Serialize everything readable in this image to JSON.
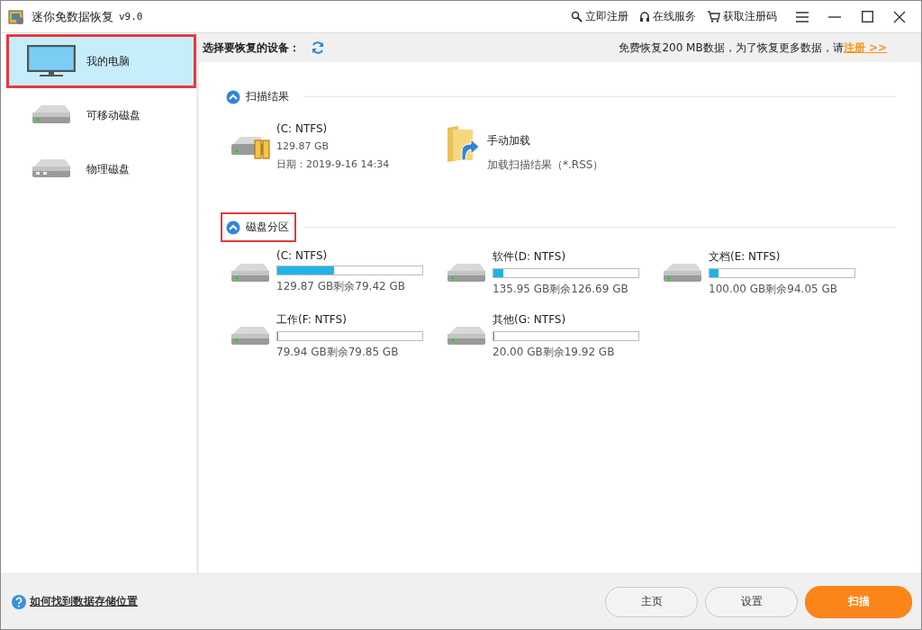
{
  "window": {
    "title": "迷你免数据恢复",
    "version": "v9.0"
  },
  "title_actions": [
    {
      "kind": "register",
      "label": "立即注册"
    },
    {
      "kind": "service",
      "label": "在线服务"
    },
    {
      "kind": "cart",
      "label": "获取注册码"
    }
  ],
  "sidebar": {
    "items": [
      {
        "kind": "computer",
        "label": "我的电脑",
        "selected": true,
        "highlighted": true
      },
      {
        "kind": "removable",
        "label": "可移动磁盘",
        "selected": false,
        "highlighted": false
      },
      {
        "kind": "physical",
        "label": "物理磁盘",
        "selected": false,
        "highlighted": false
      }
    ]
  },
  "toolbar": {
    "label": "选择要恢复的设备：",
    "notice": "免费恢复200 MB数据，为了恢复更多数据，请",
    "link": "注册 >>"
  },
  "sections": [
    {
      "kind": "results",
      "title": "扫描结果",
      "expanded": true,
      "highlighted": false,
      "items": [
        {
          "kind": "scan",
          "name": "(C: NTFS)",
          "size": "129.87 GB",
          "date": "日期：2019-9-16 14:34"
        },
        {
          "kind": "load",
          "name": "手动加载",
          "detail": "加载扫描结果（*.RSS）"
        }
      ]
    },
    {
      "kind": "partitions",
      "title": "磁盘分区",
      "expanded": true,
      "highlighted": true,
      "items": [
        {
          "name": "(C: NTFS)",
          "level": 0.39,
          "detail": "129.87 GB剩余79.42 GB"
        },
        {
          "name": "软件(D: NTFS)",
          "level": 0.07,
          "detail": "135.95 GB剩余126.69 GB"
        },
        {
          "name": "文档(E: NTFS)",
          "level": 0.06,
          "detail": "100.00 GB剩余94.05 GB"
        },
        {
          "name": "工作(F: NTFS)",
          "level": 0.001,
          "detail": "79.94 GB剩余79.85 GB"
        },
        {
          "name": "其他(G: NTFS)",
          "level": 0.004,
          "detail": "20.00 GB剩余19.92 GB"
        }
      ]
    }
  ],
  "footer": {
    "help_link": "如何找到数据存储位置",
    "buttons": [
      {
        "label": "主页",
        "primary": false
      },
      {
        "label": "设置",
        "primary": false
      },
      {
        "label": "扫描",
        "primary": true
      }
    ]
  }
}
